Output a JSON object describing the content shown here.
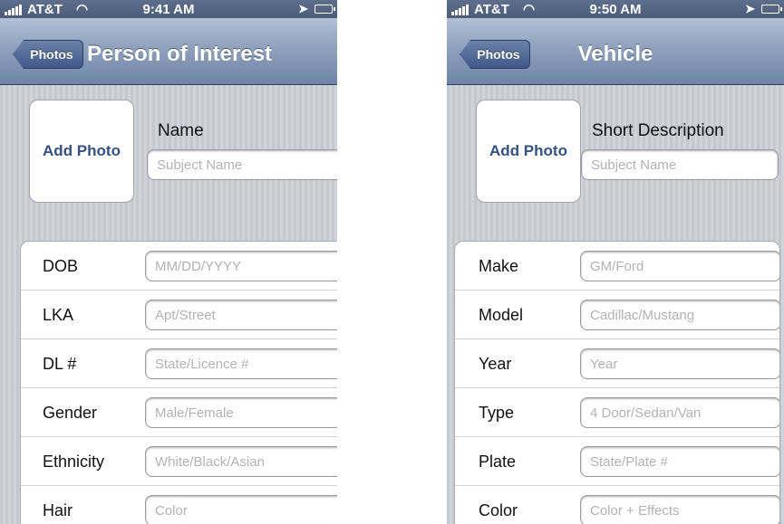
{
  "screens": [
    {
      "status": {
        "carrier": "AT&T",
        "time": "9:41 AM"
      },
      "nav": {
        "back_label": "Photos",
        "title": "Person of Interest"
      },
      "photo_button": "Add Photo",
      "header_label": "Name",
      "header_placeholder": "Subject Name",
      "fields": [
        {
          "label": "DOB",
          "placeholder": "MM/DD/YYYY"
        },
        {
          "label": "LKA",
          "placeholder": "Apt/Street"
        },
        {
          "label": "DL #",
          "placeholder": "State/Licence #"
        },
        {
          "label": "Gender",
          "placeholder": "Male/Female"
        },
        {
          "label": "Ethnicity",
          "placeholder": "White/Black/Asian"
        },
        {
          "label": "Hair",
          "placeholder": "Color"
        }
      ]
    },
    {
      "status": {
        "carrier": "AT&T",
        "time": "9:50 AM"
      },
      "nav": {
        "back_label": "Photos",
        "title": "Vehicle"
      },
      "photo_button": "Add Photo",
      "header_label": "Short Description",
      "header_placeholder": "Subject Name",
      "fields": [
        {
          "label": "Make",
          "placeholder": "GM/Ford"
        },
        {
          "label": "Model",
          "placeholder": "Cadillac/Mustang"
        },
        {
          "label": "Year",
          "placeholder": "Year"
        },
        {
          "label": "Type",
          "placeholder": "4 Door/Sedan/Van"
        },
        {
          "label": "Plate",
          "placeholder": "State/Plate #"
        },
        {
          "label": "Color",
          "placeholder": "Color + Effects"
        }
      ]
    }
  ],
  "icons": [
    "signal-bars-icon",
    "wifi-icon",
    "location-arrow-icon",
    "battery-icon"
  ],
  "colors": {
    "nav_bar": "#8ea1bd",
    "back_button": "#40598a",
    "photo_text": "#36517f",
    "status_bar": "#4a5c7a"
  }
}
